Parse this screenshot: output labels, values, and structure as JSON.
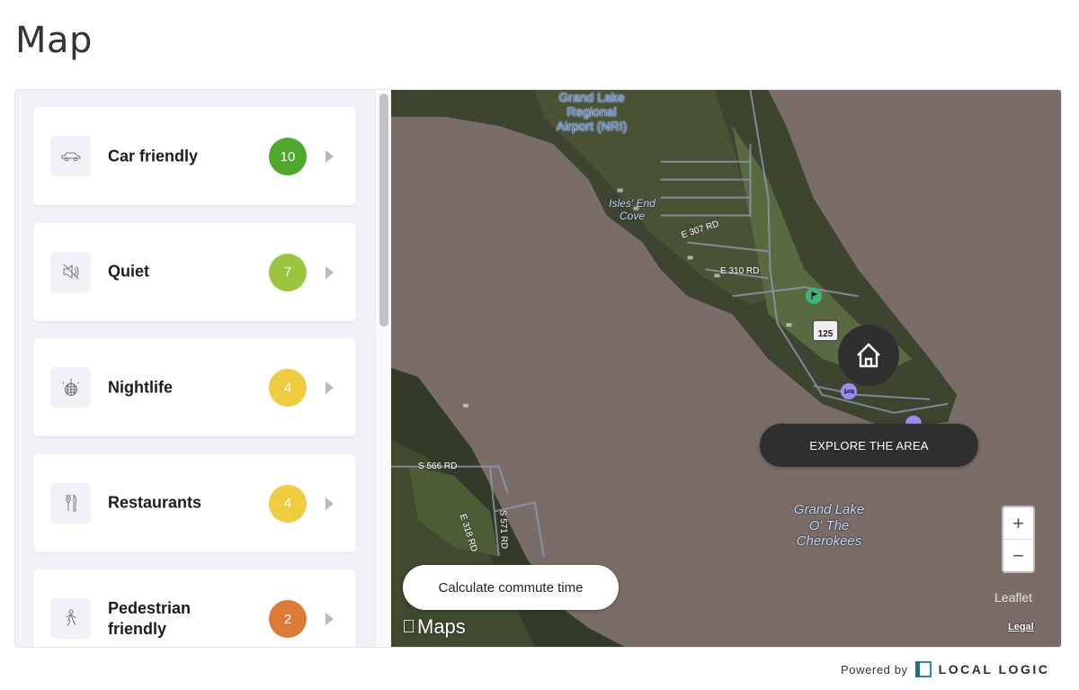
{
  "page": {
    "title": "Map"
  },
  "sidebar": {
    "items": [
      {
        "label": "Car friendly",
        "score": "10",
        "icon": "car-icon",
        "color": "#4ea82c"
      },
      {
        "label": "Quiet",
        "score": "7",
        "icon": "muted-speaker-icon",
        "color": "#9dc43e"
      },
      {
        "label": "Nightlife",
        "score": "4",
        "icon": "disco-ball-icon",
        "color": "#efcb40"
      },
      {
        "label": "Restaurants",
        "score": "4",
        "icon": "fork-knife-icon",
        "color": "#efcb40"
      },
      {
        "label": "Pedestrian friendly",
        "score": "2",
        "icon": "pedestrian-icon",
        "color": "#dd7a38"
      }
    ]
  },
  "map": {
    "labels": {
      "airport": "Grand Lake Regional Airport (NRI)",
      "cove": "Isles' End Cove",
      "lake": "Grand Lake O' The Cherokees"
    },
    "roads": [
      "E 307 RD",
      "E 310 RD",
      "S 566 RD",
      "E 318 RD",
      "S 571 RD"
    ],
    "highway_shield": "125",
    "explore_button": "EXPLORE THE AREA",
    "commute_button": "Calculate commute time",
    "zoom_in": "+",
    "zoom_out": "−",
    "provider": "Maps",
    "attribution": "Leaflet",
    "legal": "Legal"
  },
  "footer": {
    "powered_by": "Powered by",
    "brand": "LOCAL LOGIC"
  }
}
